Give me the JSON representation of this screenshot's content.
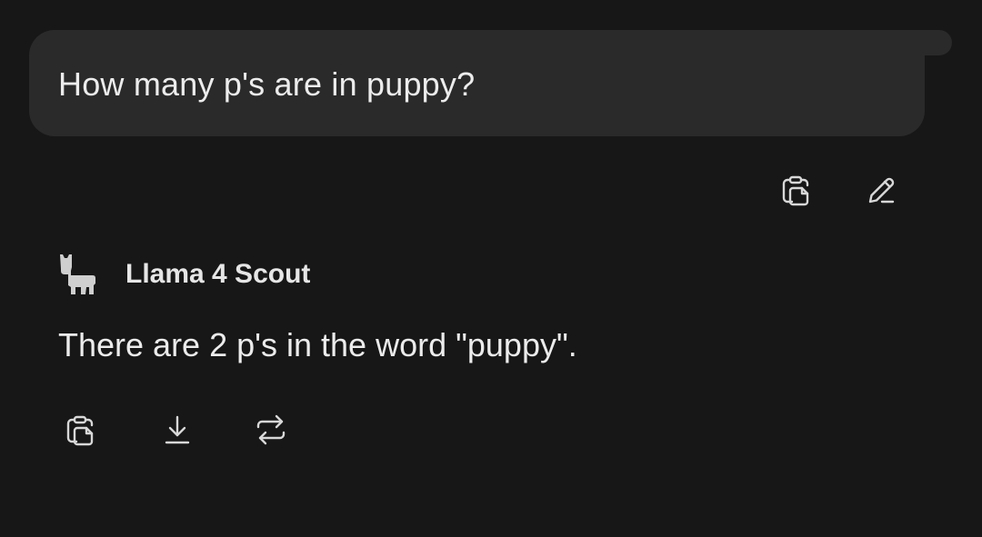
{
  "user_message": {
    "text": "How many p's are in puppy?",
    "actions": [
      {
        "icon": "copy-icon"
      },
      {
        "icon": "edit-icon"
      }
    ]
  },
  "assistant_message": {
    "model_name": "Llama 4 Scout",
    "avatar_icon": "llama-icon",
    "text": "There are 2 p's in the word \"puppy\".",
    "actions": [
      {
        "icon": "copy-icon"
      },
      {
        "icon": "download-icon"
      },
      {
        "icon": "regenerate-icon"
      }
    ]
  },
  "colors": {
    "background": "#171717",
    "bubble": "#2a2a2a",
    "text": "#ececec",
    "icon": "#d8d8d8"
  }
}
